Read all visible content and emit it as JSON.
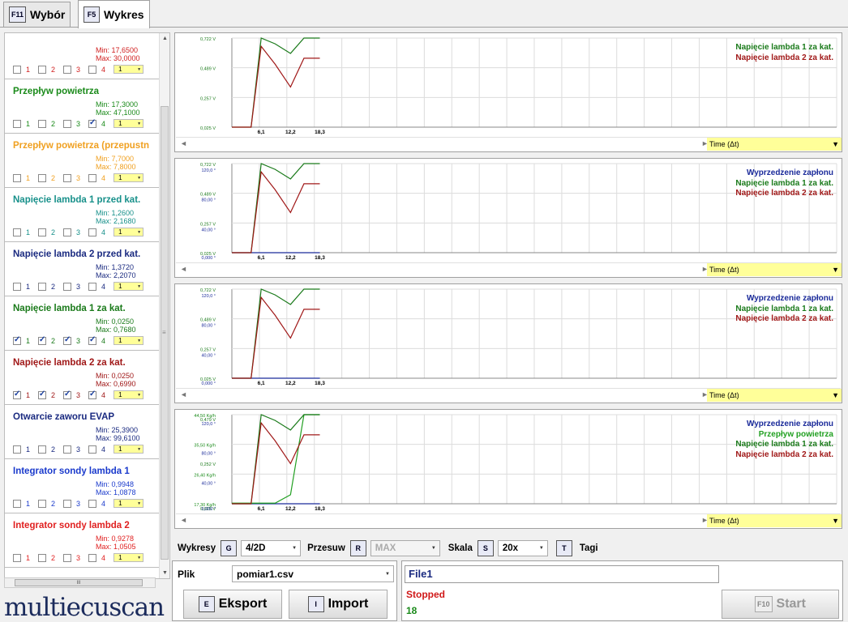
{
  "tabs": [
    {
      "key": "F11",
      "label": "Wybór"
    },
    {
      "key": "F5",
      "label": "Wykres"
    }
  ],
  "channels": [
    {
      "name": "",
      "min": "Min: 17,6500",
      "max": "Max: 30,0000",
      "color": "#d02020",
      "checks": [
        false,
        false,
        false,
        false
      ],
      "label_num": "1"
    },
    {
      "name": "Przepływ powietrza",
      "min": "Min: 17,3000",
      "max": "Max: 47,1000",
      "color": "#1a8a1a",
      "checks": [
        false,
        false,
        false,
        true
      ],
      "label_num": "1"
    },
    {
      "name": "Przepływ powietrza (przepustn",
      "min": "Min: 7,7000",
      "max": "Max: 7,8000",
      "color": "#f0a020",
      "checks": [
        false,
        false,
        false,
        false
      ],
      "label_num": "1"
    },
    {
      "name": "Napięcie lambda 1 przed kat.",
      "min": "Min: 1,2600",
      "max": "Max: 2,1680",
      "color": "#17908a",
      "checks": [
        false,
        false,
        false,
        false
      ],
      "label_num": "1"
    },
    {
      "name": "Napięcie lambda 2 przed kat.",
      "min": "Min: 1,3720",
      "max": "Max: 2,2070",
      "color": "#1a2a80",
      "checks": [
        false,
        false,
        false,
        false
      ],
      "label_num": "1"
    },
    {
      "name": "Napięcie lambda 1 za kat.",
      "min": "Min: 0,0250",
      "max": "Max: 0,7680",
      "color": "#1a7a1a",
      "checks": [
        true,
        true,
        true,
        true
      ],
      "label_num": "1"
    },
    {
      "name": "Napięcie lambda 2 za kat.",
      "min": "Min: 0,0250",
      "max": "Max: 0,6990",
      "color": "#a01818",
      "checks": [
        true,
        true,
        true,
        true
      ],
      "label_num": "1"
    },
    {
      "name": "Otwarcie zaworu EVAP",
      "min": "Min: 25,3900",
      "max": "Max: 99,6100",
      "color": "#1a2a80",
      "checks": [
        false,
        false,
        false,
        false
      ],
      "label_num": "1"
    },
    {
      "name": "Integrator sondy lambda 1",
      "min": "Min: 0,9948",
      "max": "Max: 1,0878",
      "color": "#1a3acc",
      "checks": [
        false,
        false,
        false,
        false
      ],
      "label_num": "1"
    },
    {
      "name": "Integrator sondy lambda 2",
      "min": "Min: 0,9278",
      "max": "Max: 1,0505",
      "color": "#e02020",
      "checks": [
        false,
        false,
        false,
        false
      ],
      "label_num": "1"
    }
  ],
  "check_numbers": [
    "1",
    "2",
    "3",
    "4"
  ],
  "logo": "multiecuscan",
  "time_label": "Time (Δt)",
  "x_ticks": [
    "6,1",
    "12,2",
    "18,3"
  ],
  "chart_data": [
    {
      "type": "line",
      "x": [
        0,
        4,
        6.1,
        9,
        12.2,
        15,
        18.3
      ],
      "axes": [
        {
          "ticks": [
            "0,722 V",
            "0,489 V",
            "0,257 V",
            "0,025 V"
          ],
          "color": "#1a7a1a"
        }
      ],
      "series": [
        {
          "name": "Napięcie lambda 1 za kat.",
          "color": "#1a7a1a",
          "values": [
            0.025,
            0.025,
            0.768,
            0.72,
            0.64,
            0.768,
            0.768
          ]
        },
        {
          "name": "Napięcie lambda 2 za kat.",
          "color": "#a01818",
          "values": [
            0.025,
            0.025,
            0.699,
            0.55,
            0.36,
            0.6,
            0.6
          ]
        }
      ],
      "ylim": [
        0.025,
        0.768
      ]
    },
    {
      "type": "line",
      "x": [
        0,
        4,
        6.1,
        9,
        12.2,
        15,
        18.3
      ],
      "axes": [
        {
          "ticks": [
            "0,722 V",
            "0,489 V",
            "0,257 V",
            "0,025 V"
          ],
          "color": "#1a7a1a"
        },
        {
          "ticks": [
            "120,0 °",
            "80,00 °",
            "40,00 °",
            "0,000 °"
          ],
          "color": "#1a2a9a"
        }
      ],
      "series": [
        {
          "name": "Wyprzedzenie zapłonu",
          "color": "#1a2a9a",
          "values": [
            0,
            0,
            0,
            0,
            0,
            0,
            0
          ],
          "axis": 1
        },
        {
          "name": "Napięcie lambda 1 za kat.",
          "color": "#1a7a1a",
          "values": [
            0.025,
            0.025,
            0.768,
            0.72,
            0.64,
            0.768,
            0.768
          ]
        },
        {
          "name": "Napięcie lambda 2 za kat.",
          "color": "#a01818",
          "values": [
            0.025,
            0.025,
            0.699,
            0.55,
            0.36,
            0.6,
            0.6
          ]
        }
      ],
      "ylim": [
        0.025,
        0.768
      ]
    },
    {
      "type": "line",
      "x": [
        0,
        4,
        6.1,
        9,
        12.2,
        15,
        18.3
      ],
      "axes": [
        {
          "ticks": [
            "0,722 V",
            "0,489 V",
            "0,257 V",
            "0,025 V"
          ],
          "color": "#1a7a1a"
        },
        {
          "ticks": [
            "120,0 °",
            "80,00 °",
            "40,00 °",
            "0,000 °"
          ],
          "color": "#1a2a9a"
        }
      ],
      "series": [
        {
          "name": "Wyprzedzenie zapłonu",
          "color": "#1a2a9a",
          "values": [
            0,
            0,
            0,
            0,
            0,
            0,
            0
          ],
          "axis": 1
        },
        {
          "name": "Napięcie lambda 1 za kat.",
          "color": "#1a7a1a",
          "values": [
            0.025,
            0.025,
            0.768,
            0.72,
            0.64,
            0.768,
            0.768
          ]
        },
        {
          "name": "Napięcie lambda 2 za kat.",
          "color": "#a01818",
          "values": [
            0.025,
            0.025,
            0.699,
            0.55,
            0.36,
            0.6,
            0.6
          ]
        }
      ],
      "ylim": [
        0.025,
        0.768
      ]
    },
    {
      "type": "line",
      "x": [
        0,
        4,
        6.1,
        9,
        12.2,
        15,
        18.3
      ],
      "axes": [
        {
          "ticks": [
            "44,50 Kg/h",
            "35,50 Kg/h",
            "26,40 Kg/h",
            "17,30 Kg/h"
          ],
          "color": "#1a8a1a"
        },
        {
          "ticks": [
            "0,479 V",
            "0,252 V",
            "0,025 V"
          ],
          "color": "#1a7a1a"
        },
        {
          "ticks": [
            "120,0 °",
            "80,00 °",
            "40,00 °",
            "0,000 °"
          ],
          "color": "#1a2a9a"
        }
      ],
      "series": [
        {
          "name": "Wyprzedzenie zapłonu",
          "color": "#1a2a9a",
          "values": [
            0,
            0,
            0,
            0,
            0,
            0,
            0
          ],
          "axis": 1
        },
        {
          "name": "Przepływ powietrza",
          "color": "#22a022",
          "values": [
            0.03,
            0.03,
            0.03,
            0.03,
            0.1,
            0.768,
            0.768
          ]
        },
        {
          "name": "Napięcie lambda 1 za kat.",
          "color": "#1a7a1a",
          "values": [
            0.025,
            0.025,
            0.768,
            0.72,
            0.64,
            0.768,
            0.768
          ]
        },
        {
          "name": "Napięcie lambda 2 za kat.",
          "color": "#a01818",
          "values": [
            0.025,
            0.025,
            0.699,
            0.55,
            0.36,
            0.6,
            0.6
          ]
        }
      ],
      "ylim": [
        0.025,
        0.768
      ]
    }
  ],
  "toolbar": {
    "wykresy": "Wykresy",
    "g": "G",
    "wykresy_val": "4/2D",
    "przesuw": "Przesuw",
    "r": "R",
    "przesuw_val": "MAX",
    "skala": "Skala",
    "s": "S",
    "skala_val": "20x",
    "t": "T",
    "tagi": "Tagi"
  },
  "file": {
    "label": "Plik",
    "value": "pomiar1.csv",
    "name": "File1",
    "status": "Stopped",
    "count": "18"
  },
  "buttons": {
    "export_key": "E",
    "export": "Eksport",
    "import_key": "I",
    "import": "Import",
    "start_key": "F10",
    "start": "Start"
  }
}
